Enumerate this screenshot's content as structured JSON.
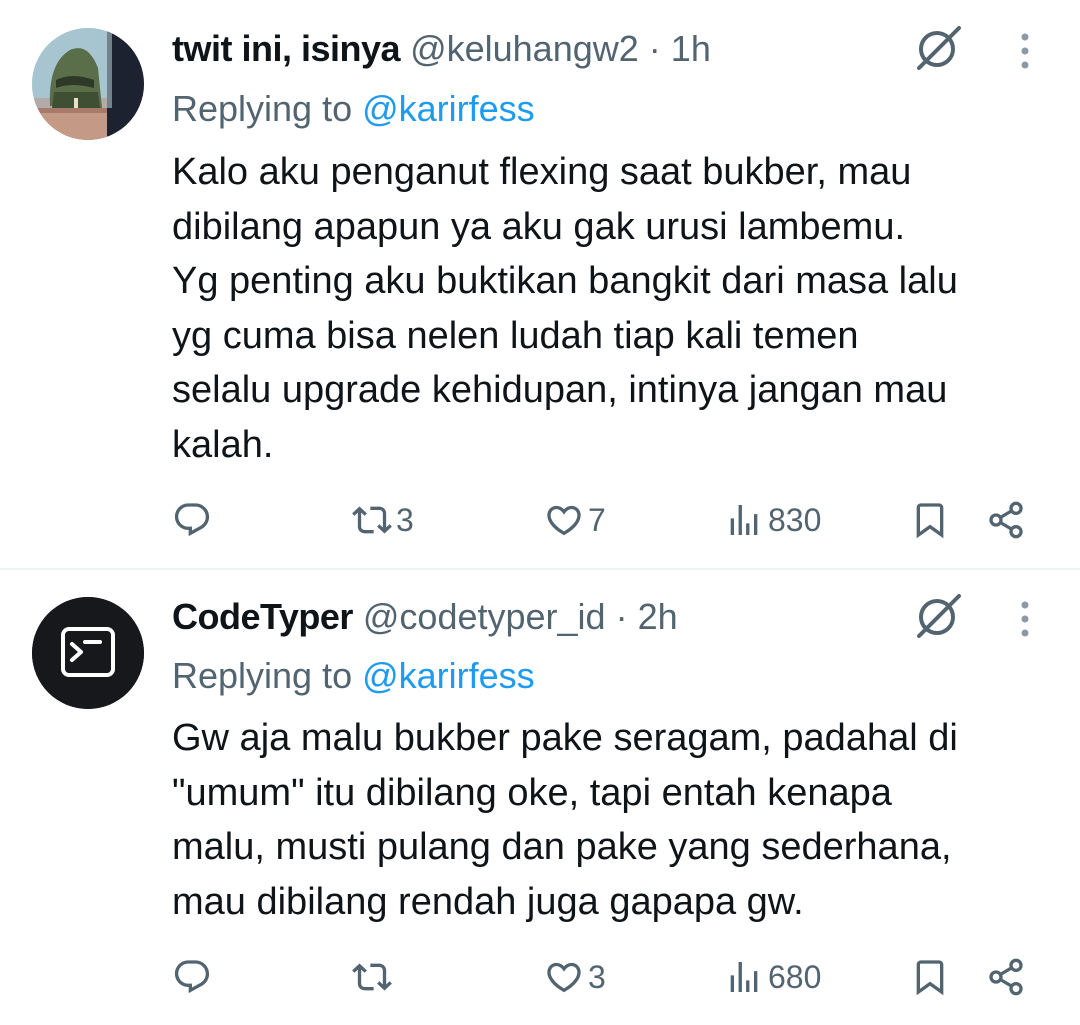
{
  "tweets": [
    {
      "name": "twit ini, isinya",
      "handle": "@keluhangw2",
      "separator": "·",
      "time": "1h",
      "replying_prefix": "Replying to ",
      "replying_to": "@karirfess",
      "text": "Kalo aku penganut flexing saat bukber, mau\ndibilang apapun ya aku gak urusi lambemu.\nYg penting aku buktikan bangkit dari masa lalu\nyg cuma bisa nelen ludah tiap kali temen\nselalu upgrade kehidupan, intinya jangan mau\nkalah.",
      "retweets": "3",
      "likes": "7",
      "views": "830"
    },
    {
      "name": "CodeTyper",
      "handle": "@codetyper_id",
      "separator": "·",
      "time": "2h",
      "replying_prefix": "Replying to ",
      "replying_to": "@karirfess",
      "text": "Gw aja malu bukber pake seragam, padahal di\n\"umum\" itu dibilang oke, tapi entah kenapa\nmalu, musti pulang dan pake yang sederhana,\nmau dibilang rendah juga gapapa gw.",
      "retweets": "",
      "likes": "3",
      "views": "680"
    }
  ],
  "colors": {
    "text": "#0f1419",
    "secondary": "#536471",
    "link": "#1d9bf0",
    "divider": "#eff3f4"
  },
  "icons": [
    "reply-icon",
    "retweet-icon",
    "like-icon",
    "views-icon",
    "bookmark-icon",
    "share-icon",
    "grok-icon",
    "more-icon",
    "terminal-icon"
  ]
}
